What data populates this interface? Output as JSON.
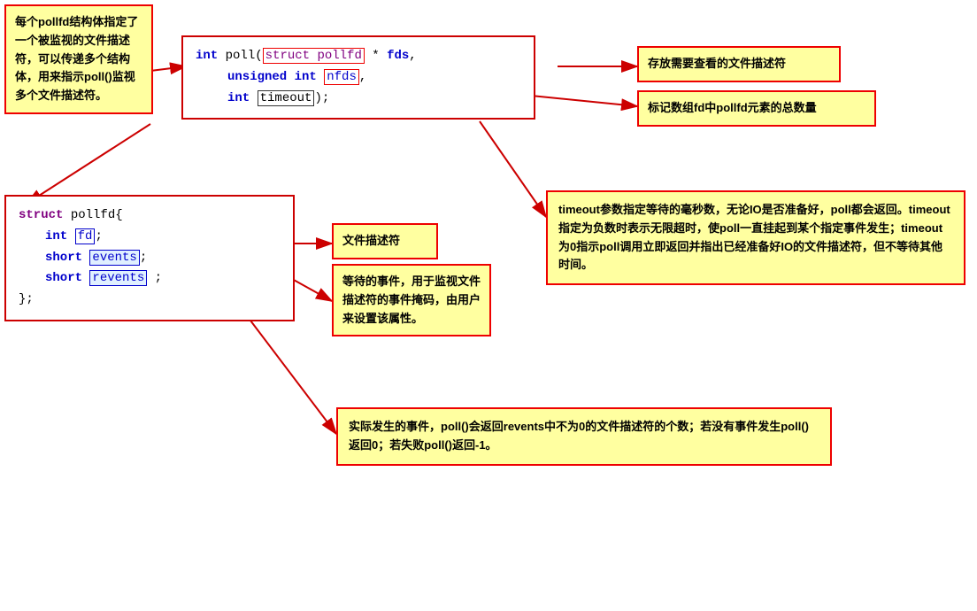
{
  "boxes": {
    "note_pollfd_struct": {
      "label": "每个pollfd结构体指定了一个被监视的文件描述符，可以传递多个结构体，用来指示poll()监视多个文件描述符。"
    },
    "note_fds": {
      "label": "存放需要查看的文件描述符"
    },
    "note_nfds": {
      "label": "标记数组fd中pollfd元素的总数量"
    },
    "note_timeout": {
      "label": "timeout参数指定等待的毫秒数，无论IO是否准备好，poll都会返回。timeout指定为负数时表示无限超时，使poll一直挂起到某个指定事件发生；timeout为0指示poll调用立即返回并指出已经准备好IO的文件描述符，但不等待其他时间。"
    },
    "note_fd_field": {
      "label": "文件描述符"
    },
    "note_events_field": {
      "label": "等待的事件，用于监视文件描述符的事件掩码，由用户来设置该属性。"
    },
    "note_revents_field": {
      "label": "实际发生的事件，poll()会返回revents中不为0的文件描述符的个数；若没有事件发生poll()返回0；若失败poll()返回-1。"
    }
  },
  "code": {
    "poll_signature": "int poll(struct pollfd * fds,",
    "poll_line2": "         unsigned int nfds,",
    "poll_line3": "         int timeout);",
    "struct_line1": "struct pollfd{",
    "struct_line2": "    int fd;",
    "struct_line3": "    short events;",
    "struct_line4": "    short revents ;",
    "struct_line5": "};"
  }
}
